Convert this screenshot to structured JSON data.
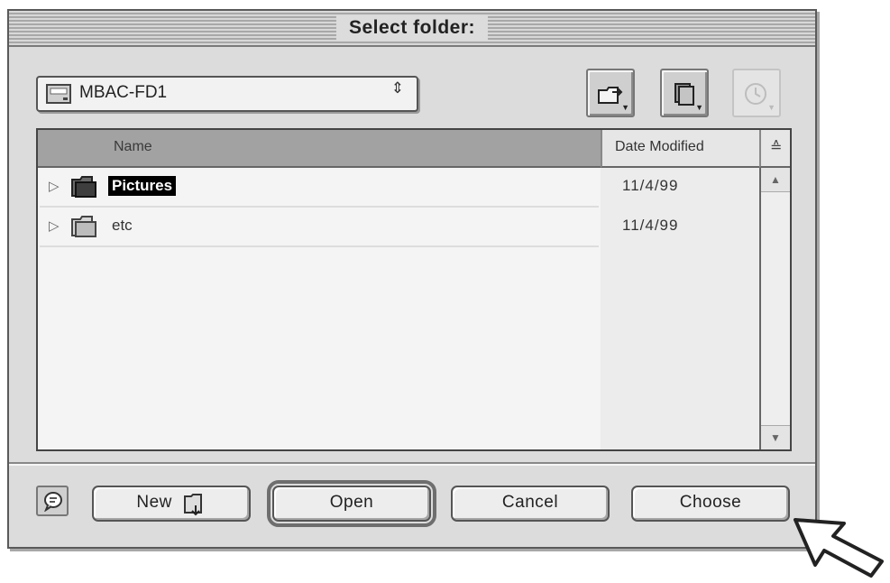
{
  "dialog": {
    "title": "Select folder:"
  },
  "location_popup": {
    "label": "MBAC-FD1",
    "arrows": "⇕"
  },
  "toolbar": {
    "shortcuts_icon": "folder-shortcut-icon",
    "favorites_icon": "favorites-icon",
    "recent_icon": "recent-clock-icon"
  },
  "list": {
    "columns": {
      "name": "Name",
      "date": "Date Modified",
      "sort": "≙"
    },
    "rows": [
      {
        "name": "Pictures",
        "date": "11/4/99",
        "selected": true
      },
      {
        "name": "etc",
        "date": "11/4/99",
        "selected": false
      }
    ],
    "disclosure_glyph": "▷",
    "scroll_up": "▲",
    "scroll_down": "▼"
  },
  "buttons": {
    "new_label": "New",
    "open_label": "Open",
    "cancel_label": "Cancel",
    "choose_label": "Choose"
  },
  "colors": {
    "dialog_bg": "#dcdcdc",
    "header_selected": "#a2a2a2",
    "selection": "#000000"
  }
}
